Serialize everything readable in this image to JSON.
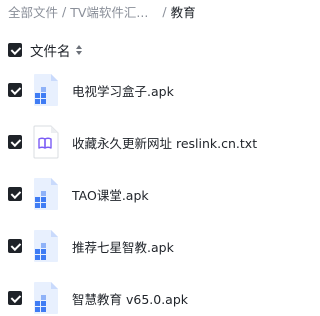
{
  "breadcrumb": {
    "items": [
      "全部文件",
      "TV端软件汇..."
    ],
    "current": "教育"
  },
  "list_header": {
    "column_label": "文件名"
  },
  "files": [
    {
      "name": "电视学习盒子.apk",
      "icon": "apk-file-icon"
    },
    {
      "name": "收藏永久更新网址 reslink.cn.txt",
      "icon": "txt-file-icon"
    },
    {
      "name": "TAO课堂.apk",
      "icon": "apk-file-icon"
    },
    {
      "name": "推荐七星智教.apk",
      "icon": "apk-file-icon"
    },
    {
      "name": "智慧教育 v65.0.apk",
      "icon": "apk-file-icon"
    }
  ],
  "colors": {
    "checkbox": "#1f2329",
    "muted_text": "#8a8f99",
    "apk_icon_bg": "#e8f0fe",
    "apk_icon_accent": "#3f7cf4",
    "txt_icon_accent": "#7b5cf5"
  }
}
